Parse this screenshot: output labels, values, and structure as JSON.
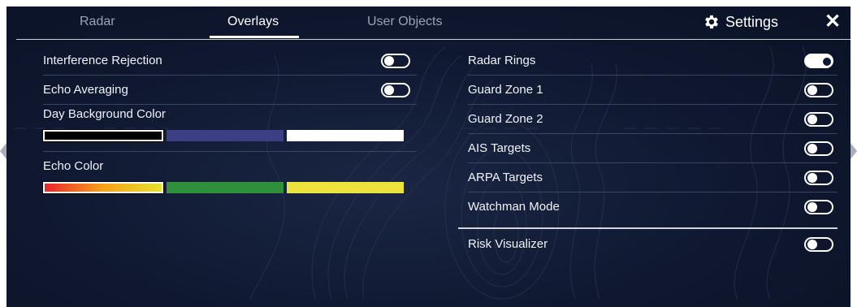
{
  "tabs": [
    {
      "label": "Radar",
      "active": false
    },
    {
      "label": "Overlays",
      "active": true
    },
    {
      "label": "User Objects",
      "active": false
    }
  ],
  "header": {
    "settings_label": "Settings",
    "settings_icon": "gear-icon",
    "close_glyph": "✕"
  },
  "left_panel": {
    "toggles": [
      {
        "label": "Interference Rejection",
        "on": false
      },
      {
        "label": "Echo Averaging",
        "on": false
      }
    ],
    "day_background_color": {
      "label": "Day Background Color",
      "options": [
        {
          "name": "black",
          "color": "#000000",
          "selected": true
        },
        {
          "name": "navy",
          "color": "#3c3f86",
          "selected": false
        },
        {
          "name": "white",
          "color": "#ffffff",
          "selected": false
        }
      ]
    },
    "echo_color": {
      "label": "Echo Color",
      "options": [
        {
          "name": "multicolor",
          "color": "linear-gradient(90deg,#e8262a,#f7a21b 50%,#e6e12f)",
          "selected": true
        },
        {
          "name": "green",
          "color": "#2f8f3a",
          "selected": false
        },
        {
          "name": "yellow",
          "color": "#ece43b",
          "selected": false
        }
      ]
    }
  },
  "right_panel": {
    "toggles": [
      {
        "label": "Radar Rings",
        "on": true
      },
      {
        "label": "Guard Zone 1",
        "on": false
      },
      {
        "label": "Guard Zone 2",
        "on": false
      },
      {
        "label": "AIS Targets",
        "on": false
      },
      {
        "label": "ARPA Targets",
        "on": false
      },
      {
        "label": "Watchman Mode",
        "on": false
      },
      {
        "label": "Risk Visualizer",
        "on": false
      }
    ]
  },
  "colors": {
    "background": "#0f1830",
    "accent": "#ffffff",
    "separator": "#3b4561"
  }
}
